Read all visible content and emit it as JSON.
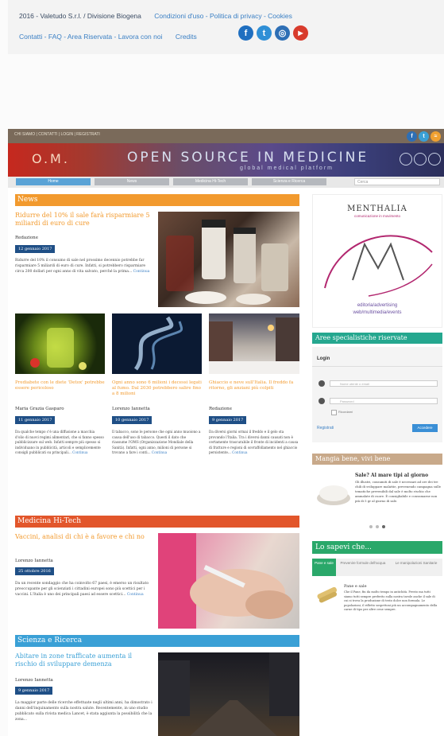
{
  "footer": {
    "copyright": "2016 - Valetudo S.r.l. / Divisione Biogena",
    "condizioni": "Condizioni d'uso",
    "privacy": "Politica di privacy",
    "cookies": "Cookies",
    "links2": "Contatti - FAQ - Area Riservata - Lavora con noi",
    "credits": "Credits",
    "social": [
      {
        "icon": "facebook-icon",
        "glyph": "f",
        "color": "#1f6fc0"
      },
      {
        "icon": "twitter-icon",
        "glyph": "t",
        "color": "#2f8fd6"
      },
      {
        "icon": "instagram-icon",
        "glyph": "◎",
        "color": "#2e6fb5"
      },
      {
        "icon": "youtube-icon",
        "glyph": "▶",
        "color": "#d83b2c"
      }
    ]
  },
  "site": {
    "topbar_links": "CHI SIAMO | CONTATTI | LOGIN | REGISTRATI",
    "logo": "O.M.",
    "title": "OPEN SOURCE IN MEDICINE",
    "subtitle": "global medical platform",
    "nav": [
      "Home",
      "News",
      "Medicina Hi-Tech",
      "Scienza e Ricerca"
    ],
    "search_placeholder": "Cerca"
  },
  "news": {
    "section": "News",
    "main": {
      "title": "Ridurre del 10% il sale farà risparmiare 5 miliardi di euro di cure",
      "author": "Redazione",
      "date": "12 gennaio 2017",
      "text": "Ridurre del 10% il consumo di sale nel prossimo decennio potrebbe far risparmiare 5 miliardi di euro di cure. Infatti, si potrebbero risparmiare circa 200 dollari per ogni anno di vita salvato, perché la prima...",
      "more": "Continua"
    },
    "cards": [
      {
        "title": "Prediabete con le diete 'Detox' potrebbe essere pericoloso",
        "author": "Maria Grazia Gasparo",
        "date": "11 gennaio 2017",
        "text": "Da qualche tempo c'è una diffusione a macchia d'olio di nuovi regimi alimentari, che si fanno spesso pubblicizzare sul web. Infatti sempre più spesso si individuano in pubblicità, articoli e semplicemente consigli pubblicati su principali...",
        "more": "Continua"
      },
      {
        "title": "Ogni anno sono 6 milioni i decessi legati al fumo. Dal 2030 potrebbero salire fino a 8 milioni",
        "author": "Lorenzo Iannetta",
        "date": "10 gennaio 2017",
        "text": "Il tabacco, sono le persone che ogni anno muoiono a causa dell'uso di tabacco. Questi il dato che riassume l'OMS (Organizzazione Mondiale della Sanità). Infatti, ogni anno, milioni di persone si trovano a fare i conti...",
        "more": "Continua"
      },
      {
        "title": "Ghiaccio e neve sull'Italia. Il freddo fa ritorno, gli anziani più colpiti",
        "author": "Redazione",
        "date": "9 gennaio 2017",
        "text": "Da diversi giorni ormai il freddo e il gelo sta provando l'Italia. Tra i diversi danni causati non è certamente trascurabile il fronte di incidenti a causa di fratture e regioni di sovraffollamento nel ghiaccio persistente...",
        "more": "Continua"
      }
    ]
  },
  "hitech": {
    "section": "Medicina Hi-Tech",
    "title": "Vaccini, analisi di chi è a favore e chi no",
    "author": "Lorenzo Iannetta",
    "date": "25 ottobre 2016",
    "text": "Da un recente sondaggio che ha coinvolto 67 paesi, è emerso un risultato preoccupante per gli scienziati i cittadini europei sono più scettici per i vaccini. L'Italia è uno dei principali paesi ad essere scettici...",
    "more": "Continua"
  },
  "scienza": {
    "section": "Scienza e Ricerca",
    "title": "Abitare in zone trafficate aumenta il rischio di sviluppare demenza",
    "author": "Lorenzo Iannetta",
    "date": "9 gennaio 2017",
    "text": "La maggior parte delle ricerche effettuate negli ultimi anni, ha dimostrato i danni dell'inquinamento sulla nostra salute. Recentemente, in uno studio pubblicato sulla rivista medica Lancet, è stata aggiunta la possibilità che la zona..."
  },
  "sidebar": {
    "ad_brand": "MENTHALIA",
    "ad_tagline": "comunicazione in movimento",
    "ad_line1": "editoria/advertising",
    "ad_line2": "web/multimedia/events",
    "reserved_title": "Aree specialistiche riservate",
    "login_title": "Login",
    "username_placeholder": "Nome utente o email",
    "password_placeholder": "Password",
    "remember": "Ricordami",
    "register": "Registrati",
    "login_button": "Accedere",
    "food_title": "Mangia bene, vivi bene",
    "food_item_title": "Sale? Al mare tipi al giorno",
    "food_item_text": "Gli illustri, consumiti di sale è necessari ad ore dei tre chili di sviluppare malattie, prevenendo campagna sulle tematiche prevenibili dal sale è molto rischio che ammalate di cuore. È consigliabile e consumarne non più di 5 gr al giorno di sale.",
    "know_title": "Lo sapevi che...",
    "know_tabs": [
      "Pane e sale",
      "Prevenire formule dell'acqua",
      "Le manipolazioni Sanitarie"
    ],
    "know_item_title": "Pane e sale",
    "know_item_text": "Che il Pane, fin da molto tempo in antichità. Presto ma tutti siamo tutti sempre preferito sulla nostra tavole anche il sale di cui si trova la produzione di testo dolce non formula. Le popolazioni, il rifletto sospettoni più un accompagnamento della carne di tipo per altre cene sempre."
  },
  "colors": {
    "orange": "#f29a2e",
    "red": "#e2562b",
    "blue": "#3aa0d6",
    "teal": "#25a78f",
    "tan": "#c8a98a",
    "green": "#2aa86a",
    "date_bg": "#1f4f86"
  }
}
